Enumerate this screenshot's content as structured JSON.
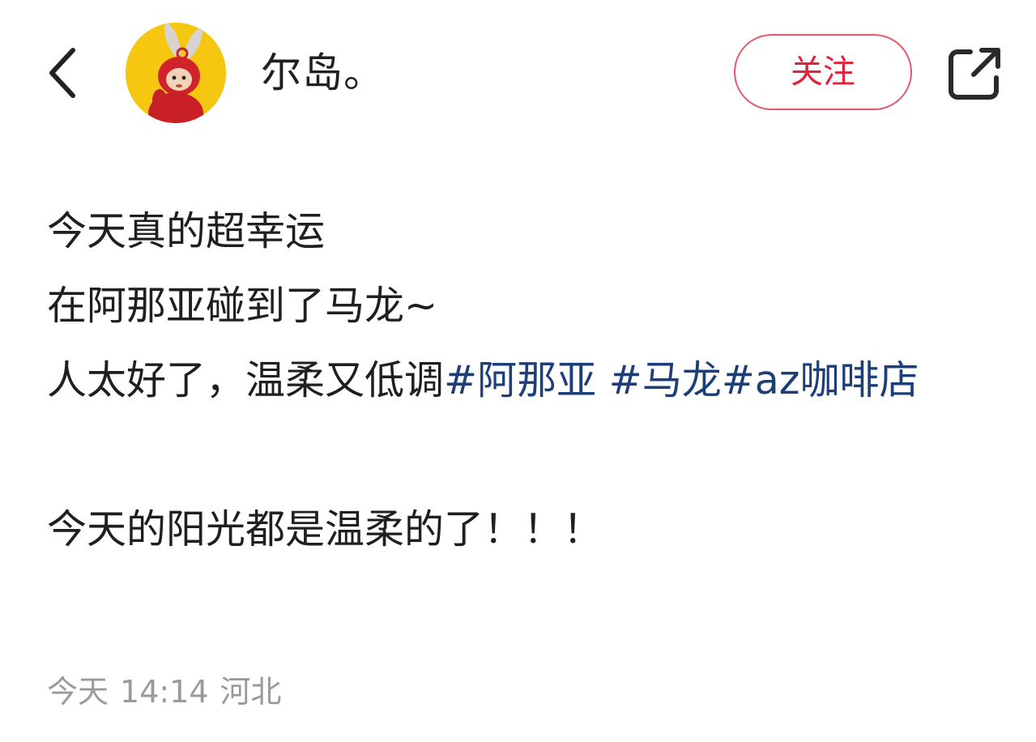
{
  "header": {
    "username": "尔岛。",
    "follow_label": "关注",
    "back_icon": "chevron-left-icon",
    "share_icon": "share-external-icon",
    "avatar_icon": "teletubby-po-avatar"
  },
  "post": {
    "line1": "今天真的超幸运",
    "line2": "在阿那亚碰到了马龙~",
    "line3_text": "人太好了，温柔又低调",
    "tag1": "#阿那亚 ",
    "tag2": "#马龙",
    "tag3": "#az咖啡店",
    "line4": "今天的阳光都是温柔的了！！！"
  },
  "meta": {
    "date": "今天",
    "time": "14:14",
    "location": "河北"
  },
  "colors": {
    "accent_follow": "#e3213b",
    "tag": "#1c3f7a",
    "meta": "#9a9a9a"
  }
}
